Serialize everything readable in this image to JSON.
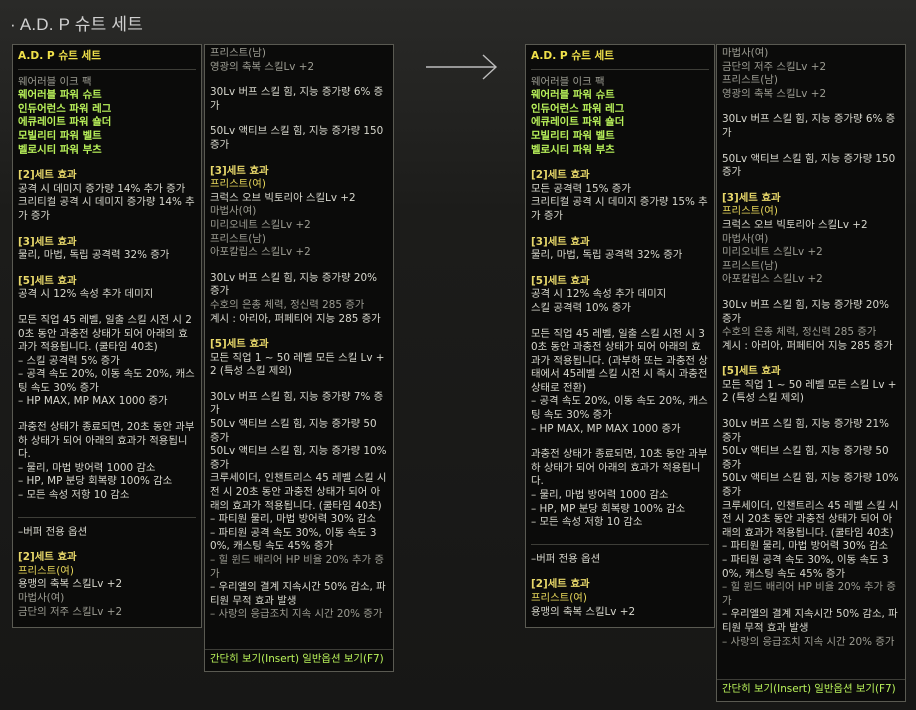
{
  "page_title": "· A.D. P 슈트 세트",
  "footer_text": "간단히 보기(Insert) 일반옵션 보기(F7)",
  "panels": {
    "left_main": {
      "lines": [
        {
          "t": "A.D. P 슈트 세트",
          "c": "name"
        },
        {
          "t": "웨어러블 이크 팩",
          "c": "dim"
        },
        {
          "t": "웨어러블 파워 슈트",
          "c": "grn"
        },
        {
          "t": "인듀어런스 파워 레그",
          "c": "grn"
        },
        {
          "t": "에큐레이트 파워 숄더",
          "c": "grn"
        },
        {
          "t": "모빌리티 파워 벨트",
          "c": "grn"
        },
        {
          "t": "벨로시티 파워 부츠",
          "c": "grn"
        },
        {
          "t": "",
          "c": "sp"
        },
        {
          "t": "[2]세트 효과",
          "c": "gld"
        },
        {
          "t": "공격 시 데미지 증가량 14% 추가 증가",
          "c": "wht"
        },
        {
          "t": "크리티컬 공격 시 데미지 증가량 14% 추가 증가",
          "c": "wht"
        },
        {
          "t": "",
          "c": "sp"
        },
        {
          "t": "[3]세트 효과",
          "c": "gld"
        },
        {
          "t": "물리, 마법, 독립 공격력 32% 증가",
          "c": "wht"
        },
        {
          "t": "",
          "c": "sp"
        },
        {
          "t": "[5]세트 효과",
          "c": "gld"
        },
        {
          "t": "공격 시 12% 속성 추가 데미지",
          "c": "wht"
        },
        {
          "t": "",
          "c": "sp"
        },
        {
          "t": "모든 직업 45 레벨, 일출 스킬 시전 시 20초 동안 과충전 상태가 되어 아래의 효과가 적용됩니다. (쿨타임 40초)",
          "c": "wht"
        },
        {
          "t": "– 스킬 공격력 5% 증가",
          "c": "wht"
        },
        {
          "t": "– 공격 속도 20%, 이동 속도 20%, 캐스팅 속도 30% 증가",
          "c": "wht"
        },
        {
          "t": "– HP MAX, MP MAX 1000 증가",
          "c": "wht"
        },
        {
          "t": "",
          "c": "sp"
        },
        {
          "t": "과충전 상태가 종료되면, 20초 동안 과부하 상태가 되어 아래의 효과가 적용됩니다.",
          "c": "wht"
        },
        {
          "t": "– 물리, 마법 방어력 1000 감소",
          "c": "wht"
        },
        {
          "t": "– HP, MP 분당 회복량 100% 감소",
          "c": "wht"
        },
        {
          "t": "– 모든 속성 저항 10 감소",
          "c": "wht"
        },
        {
          "t": "",
          "c": "sp"
        },
        {
          "t": "",
          "c": "divider"
        },
        {
          "t": "–버퍼 전용 옵션",
          "c": "wht"
        },
        {
          "t": "",
          "c": "sp"
        },
        {
          "t": "[2]세트 효과",
          "c": "gld"
        },
        {
          "t": "프리스트(여)",
          "c": "ylw"
        },
        {
          "t": "용맹의 축복 스킬Lv +2",
          "c": "wht"
        },
        {
          "t": "마법사(여)",
          "c": "dim"
        },
        {
          "t": "금단의 저주 스킬Lv +2",
          "c": "dim"
        }
      ]
    },
    "left_sub": {
      "lines": [
        {
          "t": "프리스트(남)",
          "c": "dim"
        },
        {
          "t": "영광의 축복 스킬Lv +2",
          "c": "dim"
        },
        {
          "t": "",
          "c": "sp"
        },
        {
          "t": "30Lv 버프 스킬 힘, 지능 증가량 6% 증가",
          "c": "wht"
        },
        {
          "t": "",
          "c": "sp"
        },
        {
          "t": "50Lv 액티브 스킬 힘, 지능 증가량 150 증가",
          "c": "wht"
        },
        {
          "t": "",
          "c": "sp"
        },
        {
          "t": "[3]세트 효과",
          "c": "gld"
        },
        {
          "t": "프리스트(여)",
          "c": "ylw"
        },
        {
          "t": "크럭스 오브 빅토리아 스킬Lv +2",
          "c": "wht"
        },
        {
          "t": "마법사(여)",
          "c": "dim"
        },
        {
          "t": "미리오네트 스킬Lv +2",
          "c": "dim"
        },
        {
          "t": "프리스트(남)",
          "c": "dim"
        },
        {
          "t": "아포칼립스 스킬Lv +2",
          "c": "dim"
        },
        {
          "t": "",
          "c": "sp"
        },
        {
          "t": "30Lv 버프 스킬 힘, 지능 증가량 20% 증가",
          "c": "wht"
        },
        {
          "t": "수호의 은총 체력, 정신력 285 증가",
          "c": "dim"
        },
        {
          "t": "계시 : 아리아, 퍼페티어 지능 285 증가",
          "c": "wht"
        },
        {
          "t": "",
          "c": "sp"
        },
        {
          "t": "[5]세트 효과",
          "c": "gld"
        },
        {
          "t": "모든 직업 1 ~ 50 레벨 모든 스킬 Lv +2 (특성 스킬 제외)",
          "c": "wht"
        },
        {
          "t": "",
          "c": "sp"
        },
        {
          "t": "30Lv 버프 스킬 힘, 지능 증가량 7% 증가",
          "c": "wht"
        },
        {
          "t": "50Lv 액티브 스킬 힘, 지능 증가량 50 증가",
          "c": "wht"
        },
        {
          "t": "50Lv 액티브 스킬 힘, 지능 증가량 10% 증가",
          "c": "wht"
        },
        {
          "t": "크루세이더, 인챈트리스 45 레벨 스킬 시전 시 20초 동안 과충전 상태가 되어 아래의 효과가 적용됩니다. (쿨타임 40초)",
          "c": "wht"
        },
        {
          "t": "– 파티원 물리, 마법 방어력 30% 감소",
          "c": "wht"
        },
        {
          "t": "– 파티원 공격 속도 30%, 이동 속도 30%, 캐스팅 속도 45% 증가",
          "c": "wht"
        },
        {
          "t": "– 힐 윈드 배리어 HP 비율 20% 추가 증가",
          "c": "dim"
        },
        {
          "t": "– 우리엘의 결계 지속시간 50% 감소, 파티원 무적 효과 발생",
          "c": "wht"
        },
        {
          "t": "– 사랑의 응급조치 지속 시간 20% 증가",
          "c": "dim"
        }
      ]
    },
    "right_main": {
      "lines": [
        {
          "t": "A.D. P 슈트 세트",
          "c": "name"
        },
        {
          "t": "웨어러블 이크 팩",
          "c": "dim"
        },
        {
          "t": "웨어러블 파워 슈트",
          "c": "grn"
        },
        {
          "t": "인듀어런스 파워 레그",
          "c": "grn"
        },
        {
          "t": "에큐레이트 파워 숄더",
          "c": "grn"
        },
        {
          "t": "모빌리티 파워 벨트",
          "c": "grn"
        },
        {
          "t": "벨로시티 파워 부츠",
          "c": "grn"
        },
        {
          "t": "",
          "c": "sp"
        },
        {
          "t": "[2]세트 효과",
          "c": "gld"
        },
        {
          "t": "모든 공격력 15% 증가",
          "c": "wht"
        },
        {
          "t": "크리티컬 공격 시 데미지 증가량 15% 추가 증가",
          "c": "wht"
        },
        {
          "t": "",
          "c": "sp"
        },
        {
          "t": "[3]세트 효과",
          "c": "gld"
        },
        {
          "t": "물리, 마법, 독립 공격력 32% 증가",
          "c": "wht"
        },
        {
          "t": "",
          "c": "sp"
        },
        {
          "t": "[5]세트 효과",
          "c": "gld"
        },
        {
          "t": "공격 시 12% 속성 추가 데미지",
          "c": "wht"
        },
        {
          "t": "스킬 공격력 10% 증가",
          "c": "wht"
        },
        {
          "t": "",
          "c": "sp"
        },
        {
          "t": "모든 직업 45 레벨, 일출 스킬 시전 시 30초 동안 과충전 상태가 되어 아래의 효과가 적용됩니다. (과부하 또는 과충전 상태에서 45레벨 스킬 시전 시 즉시 과충전 상태로 전환)",
          "c": "wht"
        },
        {
          "t": "– 공격 속도 20%, 이동 속도 20%, 캐스팅 속도 30% 증가",
          "c": "wht"
        },
        {
          "t": "– HP MAX, MP MAX 1000 증가",
          "c": "wht"
        },
        {
          "t": "",
          "c": "sp"
        },
        {
          "t": "과충전 상태가 종료되면, 10초 동안 과부하 상태가 되어 아래의 효과가 적용됩니다.",
          "c": "wht"
        },
        {
          "t": "– 물리, 마법 방어력 1000 감소",
          "c": "wht"
        },
        {
          "t": "– HP, MP 분당 회복량 100% 감소",
          "c": "wht"
        },
        {
          "t": "– 모든 속성 저항 10 감소",
          "c": "wht"
        },
        {
          "t": "",
          "c": "sp"
        },
        {
          "t": "",
          "c": "divider"
        },
        {
          "t": "–버퍼 전용 옵션",
          "c": "wht"
        },
        {
          "t": "",
          "c": "sp"
        },
        {
          "t": "[2]세트 효과",
          "c": "gld"
        },
        {
          "t": "프리스트(여)",
          "c": "ylw"
        },
        {
          "t": "용맹의 축복 스킬Lv +2",
          "c": "wht"
        }
      ]
    },
    "right_sub": {
      "lines": [
        {
          "t": "마법사(여)",
          "c": "dim"
        },
        {
          "t": "금단의 저주 스킬Lv +2",
          "c": "dim"
        },
        {
          "t": "프리스트(남)",
          "c": "dim"
        },
        {
          "t": "영광의 축복 스킬Lv +2",
          "c": "dim"
        },
        {
          "t": "",
          "c": "sp"
        },
        {
          "t": "30Lv 버프 스킬 힘, 지능 증가량 6% 증가",
          "c": "wht"
        },
        {
          "t": "",
          "c": "sp"
        },
        {
          "t": "50Lv 액티브 스킬 힘, 지능 증가량 150 증가",
          "c": "wht"
        },
        {
          "t": "",
          "c": "sp"
        },
        {
          "t": "[3]세트 효과",
          "c": "gld"
        },
        {
          "t": "프리스트(여)",
          "c": "ylw"
        },
        {
          "t": "크럭스 오브 빅토리아 스킬Lv +2",
          "c": "wht"
        },
        {
          "t": "마법사(여)",
          "c": "dim"
        },
        {
          "t": "미리오네트 스킬Lv +2",
          "c": "dim"
        },
        {
          "t": "프리스트(남)",
          "c": "dim"
        },
        {
          "t": "아포칼립스 스킬Lv +2",
          "c": "dim"
        },
        {
          "t": "",
          "c": "sp"
        },
        {
          "t": "30Lv 버프 스킬 힘, 지능 증가량 20% 증가",
          "c": "wht"
        },
        {
          "t": "수호의 은총 체력, 정신력 285 증가",
          "c": "dim"
        },
        {
          "t": "계시 : 아리아, 퍼페티어 지능 285 증가",
          "c": "wht"
        },
        {
          "t": "",
          "c": "sp"
        },
        {
          "t": "[5]세트 효과",
          "c": "gld"
        },
        {
          "t": "모든 직업 1 ~ 50 레벨 모든 스킬 Lv +2 (특성 스킬 제외)",
          "c": "wht"
        },
        {
          "t": "",
          "c": "sp"
        },
        {
          "t": "30Lv 버프 스킬 힘, 지능 증가량 21% 증가",
          "c": "wht"
        },
        {
          "t": "50Lv 액티브 스킬 힘, 지능 증가량 50 증가",
          "c": "wht"
        },
        {
          "t": "50Lv 액티브 스킬 힘, 지능 증가량 10% 증가",
          "c": "wht"
        },
        {
          "t": "크루세이더, 인챈트리스 45 레벨 스킬 시전 시 20초 동안 과충전 상태가 되어 아래의 효과가 적용됩니다. (쿨타임 40초)",
          "c": "wht"
        },
        {
          "t": "– 파티원 물리, 마법 방어력 30% 감소",
          "c": "wht"
        },
        {
          "t": "– 파티원 공격 속도 30%, 이동 속도 30%, 캐스팅 속도 45% 증가",
          "c": "wht"
        },
        {
          "t": "– 힐 윈드 배리어 HP 비율 20% 추가 증가",
          "c": "dim"
        },
        {
          "t": "– 우리엘의 결계 지속시간 50% 감소, 파티원 무적 효과 발생",
          "c": "wht"
        },
        {
          "t": "– 사랑의 응급조치 지속 시간 20% 증가",
          "c": "dim"
        }
      ]
    }
  }
}
